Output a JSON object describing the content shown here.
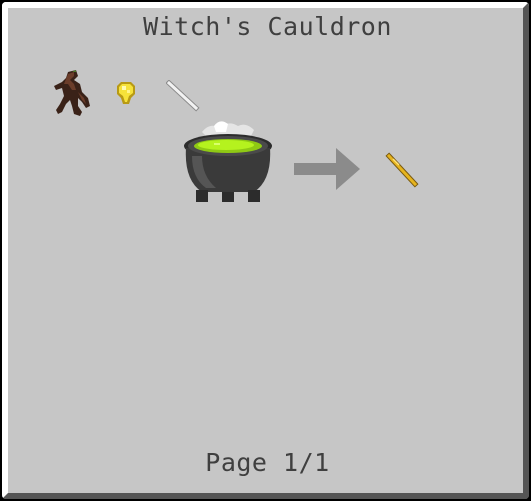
{
  "gui": {
    "title": "Witch's Cauldron",
    "page_label": "Page 1/1"
  },
  "recipe": {
    "ingredients": [
      {
        "icon": "mandrake-root-icon"
      },
      {
        "icon": "glowstone-dust-icon"
      },
      {
        "icon": "white-stick-icon"
      }
    ],
    "station": {
      "icon": "cauldron-icon"
    },
    "arrow": {
      "icon": "arrow-right-icon"
    },
    "output": {
      "icon": "golden-stick-icon"
    }
  },
  "colors": {
    "panel_bg": "#c6c6c6",
    "text": "#3f3f3f",
    "potion_green": "#b5f21e",
    "output_gold": "#e6b41e"
  }
}
